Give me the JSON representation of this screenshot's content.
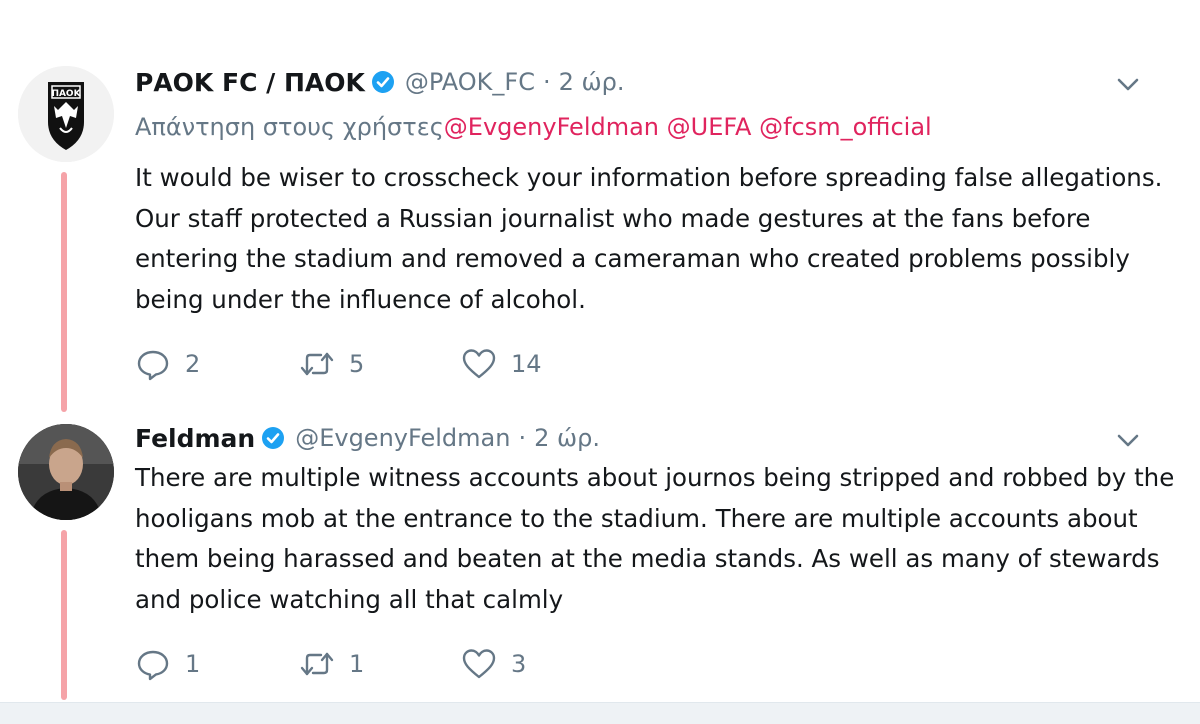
{
  "colors": {
    "mention": "#e0245e",
    "secondary_text": "#657786",
    "thread_line": "#f5a3a8",
    "verified_badge": "#1da1f2"
  },
  "tweet1": {
    "name": "ΡΑΟΚ FC / ΠΑΟΚ",
    "handle": "@PAOK_FC",
    "separator": "·",
    "time": "2 ώρ.",
    "replying_prefix": "Απάντηση στους χρήστες",
    "mentions": [
      "@EvgenyFeldman",
      "@UEFA",
      "@fcsm_official"
    ],
    "text": "It would be wiser to crosscheck your information before spreading false allegations. Our staff protected a Russian journalist who made gestures at the fans before entering the stadium and removed a cameraman who created problems possibly being under the influence of alcohol.",
    "reply_count": "2",
    "retweet_count": "5",
    "like_count": "14",
    "icons": {
      "avatar": "paok-logo-avatar",
      "verified": "verified-badge-icon",
      "menu": "chevron-down-icon"
    }
  },
  "tweet2": {
    "name": "Feldman",
    "handle": "@EvgenyFeldman",
    "separator": "·",
    "time": "2 ώρ.",
    "text": "There are multiple witness accounts about journos being stripped and robbed by the hooligans mob at the entrance to the stadium. There are multiple accounts about them being harassed and beaten at the media stands. As well as many of stewards and police watching all that calmly",
    "reply_count": "1",
    "retweet_count": "1",
    "like_count": "3",
    "icons": {
      "avatar": "user-photo-avatar",
      "verified": "verified-badge-icon",
      "menu": "chevron-down-icon"
    }
  }
}
